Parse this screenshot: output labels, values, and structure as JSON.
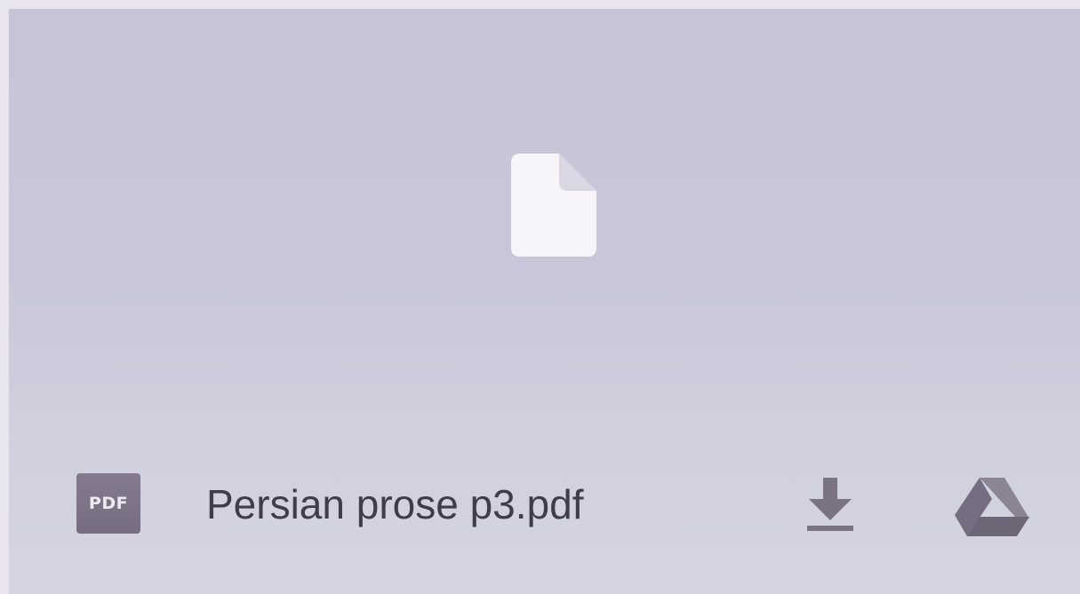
{
  "preview": {
    "icon": "file-icon"
  },
  "attachment": {
    "type_badge": "PDF",
    "file_name": "Persian prose p3.pdf"
  },
  "actions": {
    "download_icon": "download-icon",
    "drive_icon": "google-drive-icon"
  },
  "colors": {
    "card_background": "#c8c6d8",
    "badge_background": "#7d7488",
    "text": "#3f3d4a",
    "action_icon": "#7a7384",
    "preview_icon": "#f7f5fa"
  }
}
